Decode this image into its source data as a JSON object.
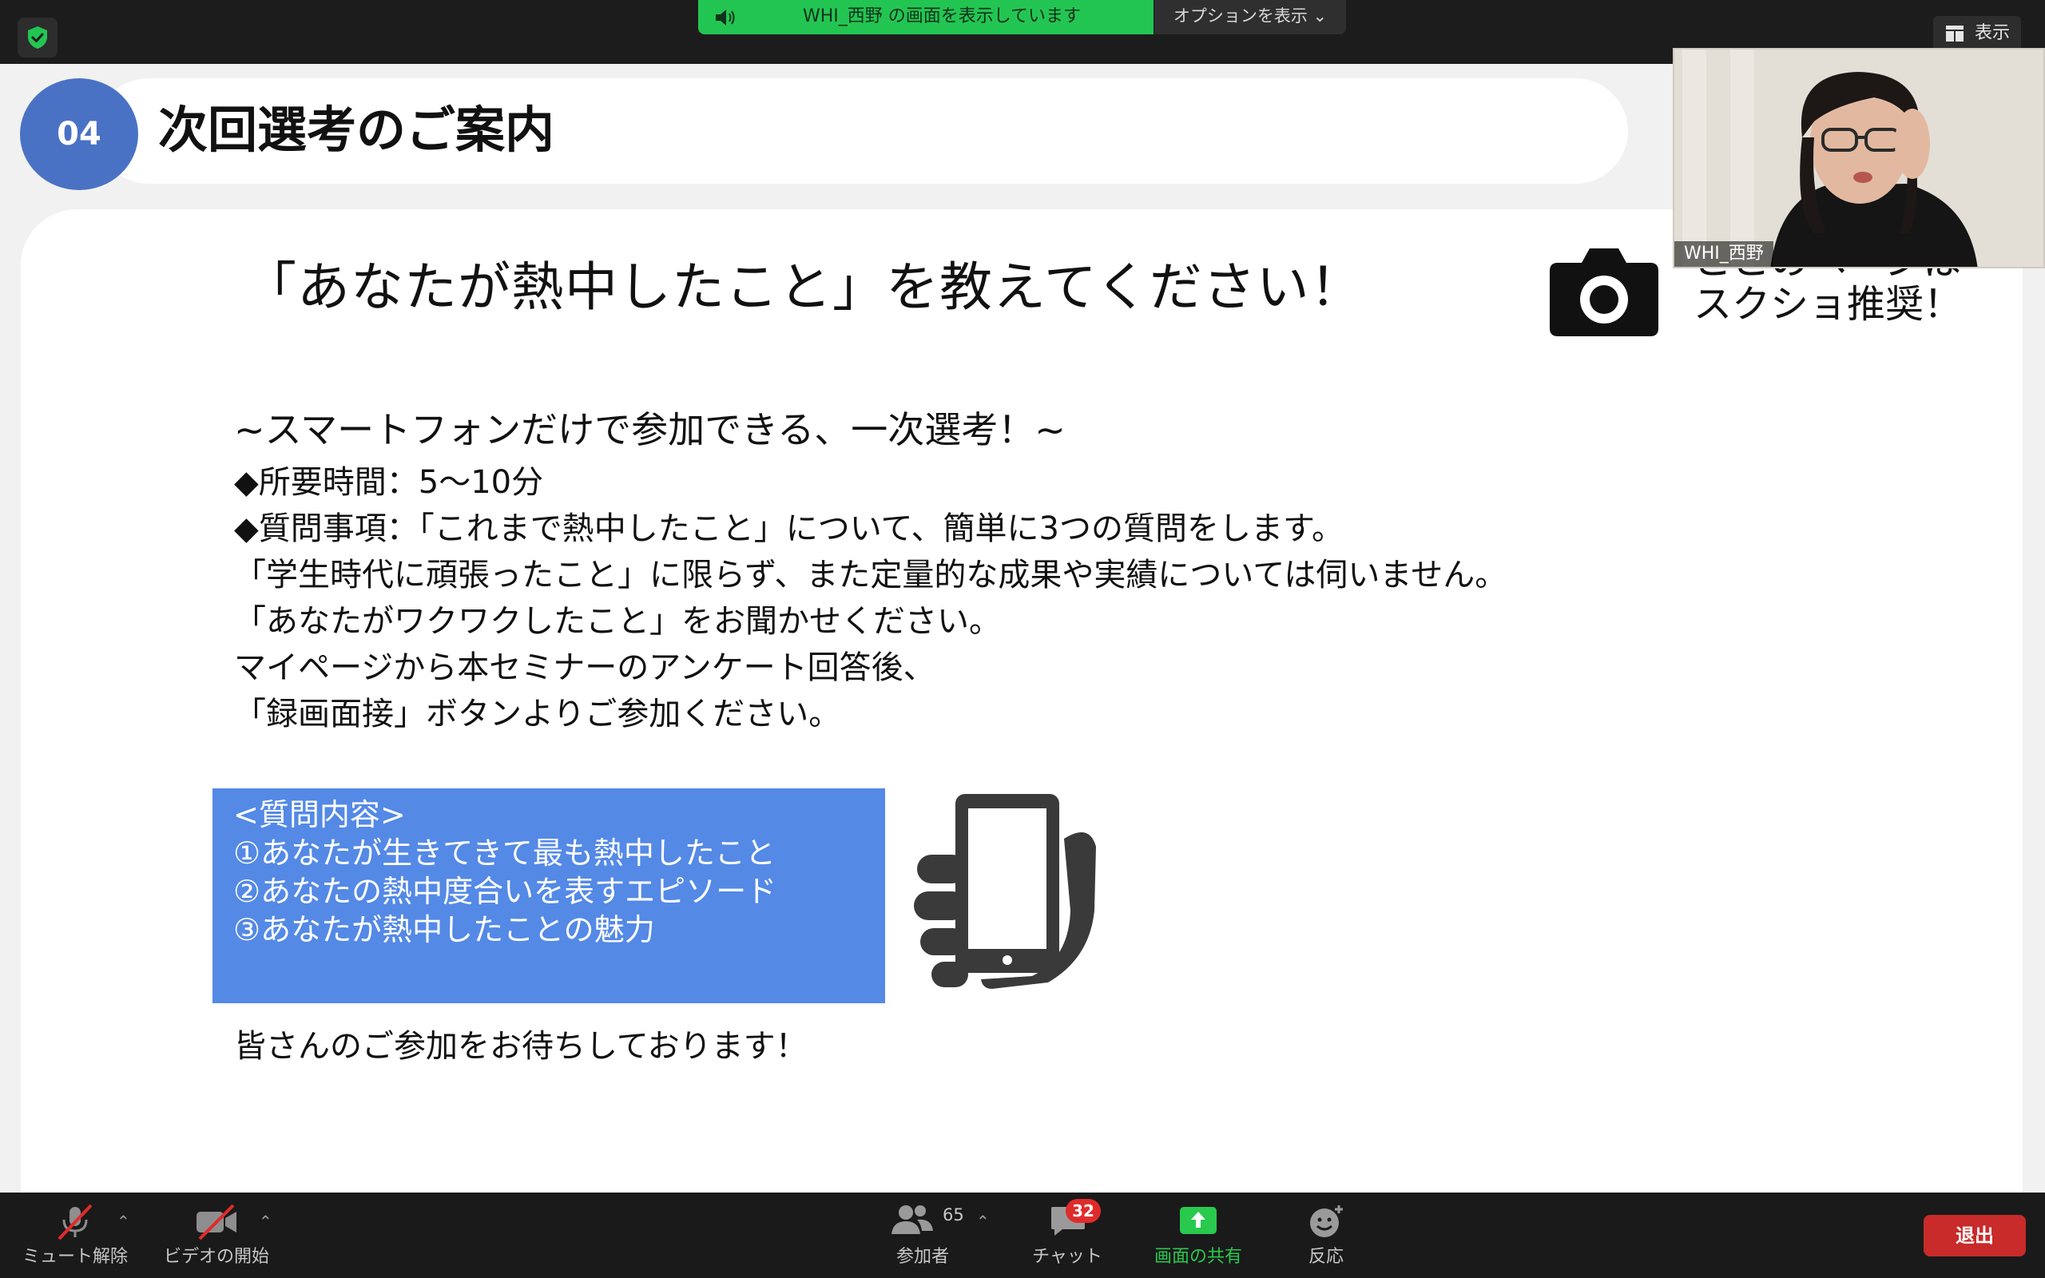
{
  "share_banner": {
    "text": "WHI_西野 の画面を表示しています"
  },
  "options_button": {
    "label": "オプションを表示 ⌄"
  },
  "view_button": {
    "label": "表示"
  },
  "slide": {
    "badge": "04",
    "title": "次回選考のご案内",
    "headline": "「あなたが熱中したこと」を教えてください！",
    "screenshot_note": [
      "ここのページは",
      "スクショ推奨！"
    ],
    "subtitle": "~スマートフォンだけで参加できる、一次選考！~",
    "lines": [
      "◆所要時間：5〜10分",
      "◆質問事項：「これまで熱中したこと」について、簡単に3つの質問をします。",
      "「学生時代に頑張ったこと」に限らず、また定量的な成果や実績については伺いません。",
      "「あなたがワクワクしたこと」をお聞かせください。",
      "マイページから本セミナーのアンケート回答後、",
      "「録画面接」ボタンよりご参加ください。"
    ],
    "question_box": [
      "<質問内容>",
      "①あなたが生きてきて最も熱中したこと",
      "②あなたの熱中度合いを表すエピソード",
      "③あなたが熱中したことの魅力"
    ],
    "closing": "皆さんのご参加をお待ちしております！"
  },
  "participant": {
    "name": "WHI_西野"
  },
  "toolbar": {
    "unmute": "ミュート解除",
    "start_video": "ビデオの開始",
    "participants": "参加者",
    "participant_count": "65",
    "chat": "チャット",
    "chat_unread": "32",
    "share_screen": "画面の共有",
    "reactions": "反応",
    "leave": "退出"
  },
  "colors": {
    "share_green": "#23c552",
    "badge_blue": "#4a72c4",
    "question_box": "#5489e6",
    "leave_red": "#c92a2a"
  },
  "icons": [
    "shield-check-icon",
    "speaker-icon",
    "grid-view-icon",
    "camera-icon",
    "smartphone-hand-icon",
    "microphone-muted-icon",
    "video-off-icon",
    "participants-icon",
    "chat-icon",
    "share-screen-icon",
    "reaction-icon"
  ]
}
